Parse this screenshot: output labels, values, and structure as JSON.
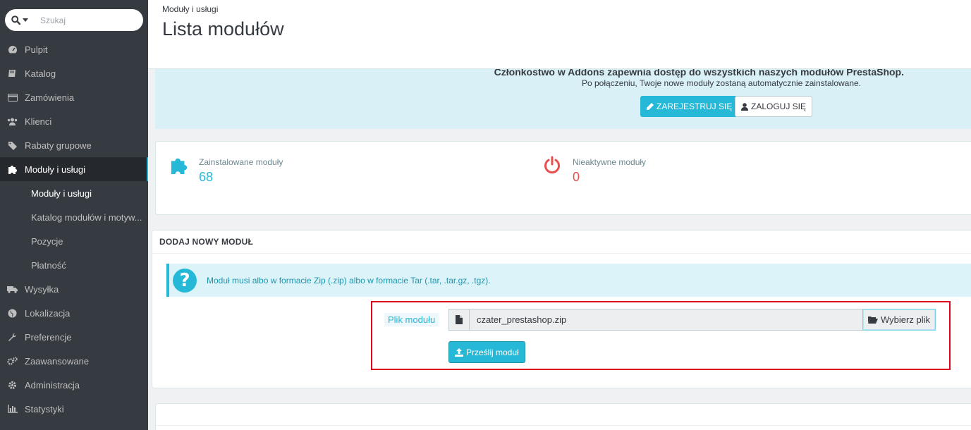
{
  "search": {
    "placeholder": "Szukaj"
  },
  "sidebar": {
    "items": [
      {
        "label": "Pulpit",
        "icon": "dashboard-icon"
      },
      {
        "label": "Katalog",
        "icon": "book-icon"
      },
      {
        "label": "Zamówienia",
        "icon": "credit-card-icon"
      },
      {
        "label": "Klienci",
        "icon": "users-icon"
      },
      {
        "label": "Rabaty grupowe",
        "icon": "tags-icon"
      },
      {
        "label": "Moduły i usługi",
        "icon": "puzzle-icon"
      }
    ],
    "subitems": [
      {
        "label": "Moduły i usługi"
      },
      {
        "label": "Katalog modułów i motyw..."
      },
      {
        "label": "Pozycje"
      },
      {
        "label": "Płatność"
      }
    ],
    "items_after": [
      {
        "label": "Wysyłka",
        "icon": "truck-icon"
      },
      {
        "label": "Lokalizacja",
        "icon": "globe-icon"
      },
      {
        "label": "Preferencje",
        "icon": "wrench-icon"
      },
      {
        "label": "Zaawansowane",
        "icon": "cogs-icon"
      },
      {
        "label": "Administracja",
        "icon": "cog-icon"
      },
      {
        "label": "Statystyki",
        "icon": "bar-chart-icon"
      }
    ]
  },
  "header": {
    "breadcrumb": "Moduły i usługi",
    "title": "Lista modułów"
  },
  "addons": {
    "line1": "Członkostwo w Addons zapewnia dostęp do wszystkich naszych modułów PrestaShop.",
    "line2": "Po połączeniu, Twoje nowe moduły zostaną automatycznie zainstalowane.",
    "register_label": "ZAREJESTRUJ SIĘ",
    "login_label": "ZALOGUJ SIĘ"
  },
  "kpi": {
    "installed_label": "Zainstalowane moduły",
    "installed_value": "68",
    "inactive_label": "Nieaktywne moduły",
    "inactive_value": "0"
  },
  "add_module": {
    "heading": "DODAJ NOWY MODUŁ",
    "info_text": "Moduł musi albo w formacie Zip (.zip) albo w formacie Tar (.tar, .tar.gz, .tgz).",
    "file_label": "Plik modułu",
    "file_value": "czater_prestashop.zip",
    "choose_label": "Wybierz plik",
    "upload_label": "Prześlij moduł"
  },
  "colors": {
    "accent": "#25b9d7",
    "sidebar_bg": "#363a41",
    "danger": "#e84e4e",
    "highlight": "#e0001b"
  }
}
